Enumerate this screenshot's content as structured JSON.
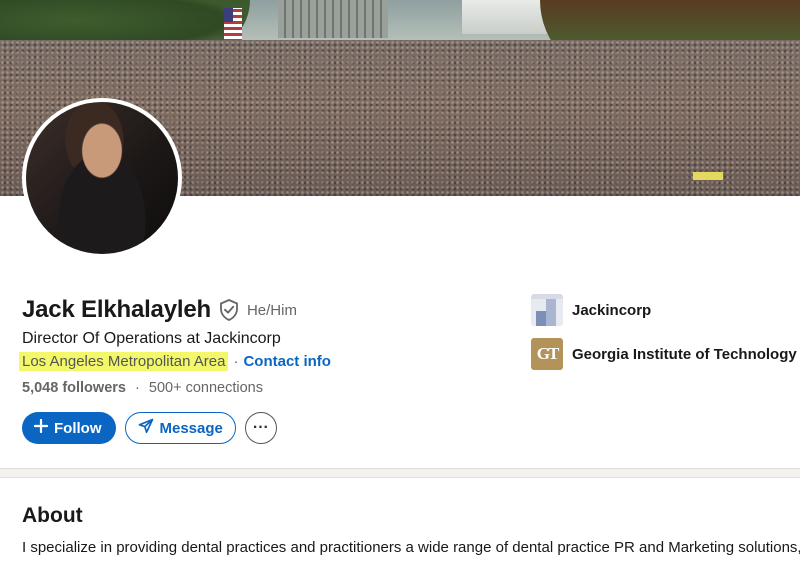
{
  "profile": {
    "name": "Jack Elkhalayleh",
    "pronouns": "He/Him",
    "headline": "Director Of Operations at Jackincorp",
    "location": "Los Angeles Metropolitan Area",
    "separator": "·",
    "contact_info": "Contact info",
    "followers": "5,048 followers",
    "connections": "500+ connections",
    "verified_icon": "shield-check-icon"
  },
  "actions": {
    "follow_label": "Follow",
    "message_label": "Message",
    "more_label": "···"
  },
  "orgs": [
    {
      "name": "Jackincorp",
      "logo": "jackincorp-logo"
    },
    {
      "name": "Georgia Institute of Technology",
      "logo": "georgia-tech-logo",
      "logo_text": "GT"
    }
  ],
  "about": {
    "title": "About",
    "text": "I specialize in providing dental practices and practitioners a wide range of dental practice PR and Marketing solutions,"
  },
  "colors": {
    "primary": "#0a66c2",
    "highlight": "#f3f76a",
    "gt_gold": "#b3935a"
  }
}
